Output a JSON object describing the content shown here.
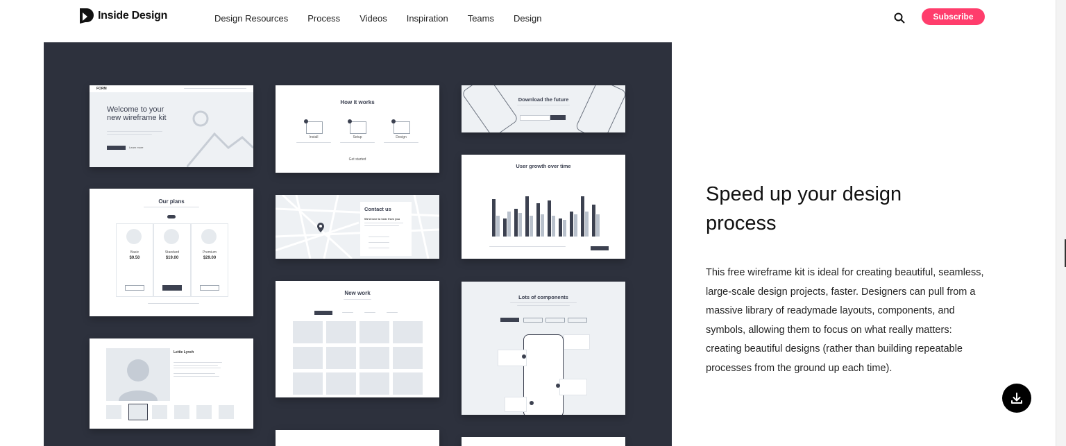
{
  "header": {
    "logo_text": "Inside Design",
    "nav": [
      "Design Resources",
      "Process",
      "Videos",
      "Inspiration",
      "Teams",
      "Design"
    ],
    "subscribe_label": "Subscribe",
    "icons": {
      "search": "search-icon",
      "logo": "inside-design-logo"
    }
  },
  "hero": {
    "cards": {
      "welcome": {
        "brand": "FORM",
        "title_line1": "Welcome to your",
        "title_line2": "new wireframe kit",
        "link": "Learn more"
      },
      "how_it_works": {
        "title": "How it works",
        "steps": [
          "Install",
          "Setup",
          "Design"
        ],
        "link": "Get started"
      },
      "download": {
        "title": "Download the future"
      },
      "user_growth": {
        "title": "User growth over time"
      },
      "our_plans": {
        "title": "Our plans",
        "prices": [
          "$9.50",
          "$19.00",
          "$29.00"
        ],
        "plan_names": [
          "Basic",
          "Standard",
          "Premium"
        ]
      },
      "contact": {
        "title": "Contact us",
        "subtitle": "We'd love to hear from you"
      },
      "new_work": {
        "title": "New work"
      },
      "components": {
        "title": "Lots of components"
      },
      "profile": {
        "name": "Lettie Lynch"
      }
    }
  },
  "content": {
    "headline": "Speed up your design process",
    "body": "This free wireframe kit is ideal for creating beautiful, seamless, large-scale design projects, faster. Designers can pull from a massive library of readymade layouts, components, and symbols, allowing them to focus on what really matters: creating beautiful designs (rather than building repeatable processes from the ground up each time)."
  },
  "download_button": {
    "icon": "download-icon"
  },
  "colors": {
    "accent": "#ff3d6c",
    "hero_bg": "#2d313d",
    "card_dark": "#3c4150"
  }
}
